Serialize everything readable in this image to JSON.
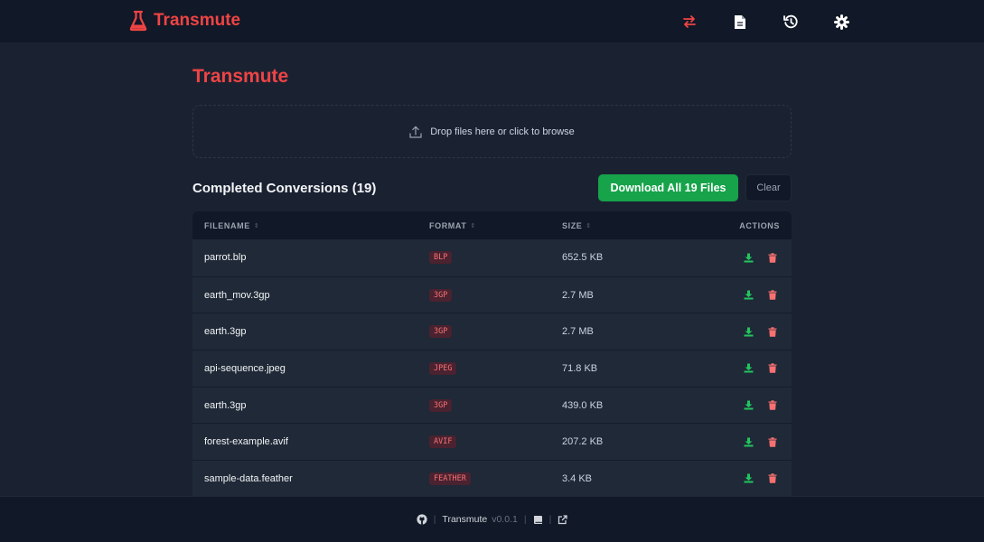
{
  "header": {
    "brand": "Transmute",
    "nav_icons": [
      "swap-icon",
      "file-icon",
      "history-icon",
      "gear-icon"
    ]
  },
  "page": {
    "title": "Transmute",
    "dropzone_text": "Drop files here or click to browse"
  },
  "conversions": {
    "title": "Completed Conversions (19)",
    "download_all_label": "Download All 19 Files",
    "clear_label": "Clear",
    "columns": [
      "FILENAME",
      "FORMAT",
      "SIZE",
      "ACTIONS"
    ],
    "rows": [
      {
        "filename": "parrot.blp",
        "format": "BLP",
        "size": "652.5 KB"
      },
      {
        "filename": "earth_mov.3gp",
        "format": "3GP",
        "size": "2.7 MB"
      },
      {
        "filename": "earth.3gp",
        "format": "3GP",
        "size": "2.7 MB"
      },
      {
        "filename": "api-sequence.jpeg",
        "format": "JPEG",
        "size": "71.8 KB"
      },
      {
        "filename": "earth.3gp",
        "format": "3GP",
        "size": "439.0 KB"
      },
      {
        "filename": "forest-example.avif",
        "format": "AVIF",
        "size": "207.2 KB"
      },
      {
        "filename": "sample-data.feather",
        "format": "FEATHER",
        "size": "3.4 KB"
      }
    ]
  },
  "footer": {
    "app_name": "Transmute",
    "version": "v0.0.1"
  },
  "colors": {
    "accent": "#ef4444",
    "success": "#16a34a",
    "background": "#1a2232",
    "surface": "#1f2937",
    "bar": "#111827"
  }
}
